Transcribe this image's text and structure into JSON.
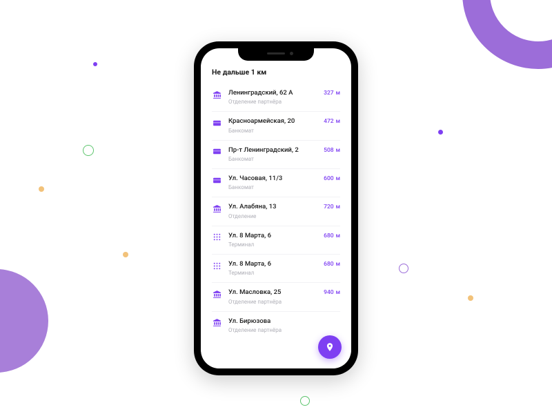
{
  "header": "Не дальше 1 км",
  "distance_unit": "м",
  "fab_label": "map",
  "colors": {
    "accent": "#7e3ff2"
  },
  "items": [
    {
      "icon": "bank",
      "name": "Ленинградский, 62 А",
      "type": "Отделение партнёра",
      "distance": "327"
    },
    {
      "icon": "card",
      "name": "Красноармейская, 20",
      "type": "Банкомат",
      "distance": "472"
    },
    {
      "icon": "card",
      "name": "Пр-т Ленинградский, 2",
      "type": "Банкомат",
      "distance": "508"
    },
    {
      "icon": "card",
      "name": "Ул. Часовая, 11/3",
      "type": "Банкомат",
      "distance": "600"
    },
    {
      "icon": "bank",
      "name": "Ул. Алабяна, 13",
      "type": "Отделение",
      "distance": "720"
    },
    {
      "icon": "terminal",
      "name": "Ул. 8 Марта, 6",
      "type": "Терминал",
      "distance": "680"
    },
    {
      "icon": "terminal",
      "name": "Ул. 8 Марта, 6",
      "type": "Терминал",
      "distance": "680"
    },
    {
      "icon": "bank",
      "name": "Ул. Масловка, 25",
      "type": "Отделение партнёра",
      "distance": "940"
    },
    {
      "icon": "bank",
      "name": "Ул. Бирюзова",
      "type": "Отделение партнёра",
      "distance": ""
    }
  ]
}
